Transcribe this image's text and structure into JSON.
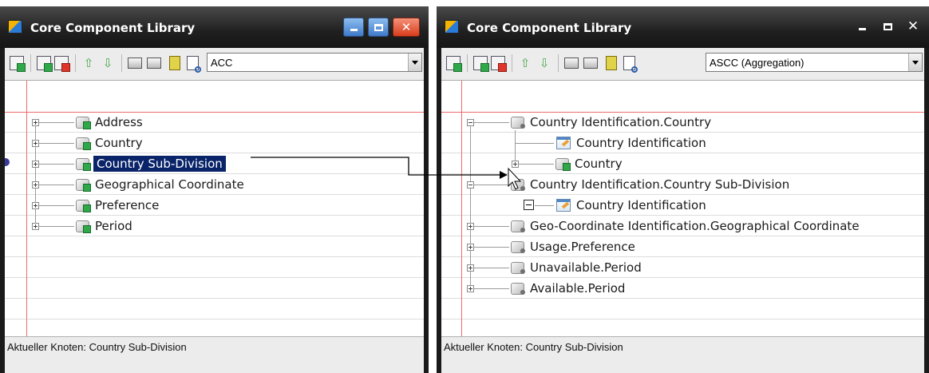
{
  "left_window": {
    "title": "Core Component Library",
    "combo_value": "ACC",
    "tree": [
      {
        "label": "Address"
      },
      {
        "label": "Country"
      },
      {
        "label": "Country Sub-Division",
        "selected": true
      },
      {
        "label": "Geographical Coordinate"
      },
      {
        "label": "Preference"
      },
      {
        "label": "Period"
      }
    ],
    "status_text": "Aktueller Knoten: Country Sub-Division"
  },
  "right_window": {
    "title": "Core Component Library",
    "combo_value": "ASCC (Aggregation)",
    "tree": {
      "n0": "Country Identification.Country",
      "n0_c0": "Country Identification",
      "n0_c1": "Country",
      "n1": "Country Identification.Country Sub-Division",
      "n1_c0": "Country Identification",
      "n2": "Geo-Coordinate Identification.Geographical Coordinate",
      "n3": "Usage.Preference",
      "n4": "Unavailable.Period",
      "n5": "Available.Period"
    },
    "status_text": "Aktueller Knoten: Country Sub-Division"
  },
  "icons": {
    "toolbar": [
      "add-node-icon",
      "add-child-icon",
      "remove-node-icon",
      "move-up-icon",
      "move-down-icon",
      "print-icon",
      "print-preview-icon",
      "book-icon",
      "search-icon"
    ],
    "tree_node": "cube-icon",
    "leaf_node": "bbie-icon"
  },
  "colors": {
    "selection": "#0a246a",
    "close_button": "#d83d1c",
    "grid_red": "#f06a6a"
  }
}
